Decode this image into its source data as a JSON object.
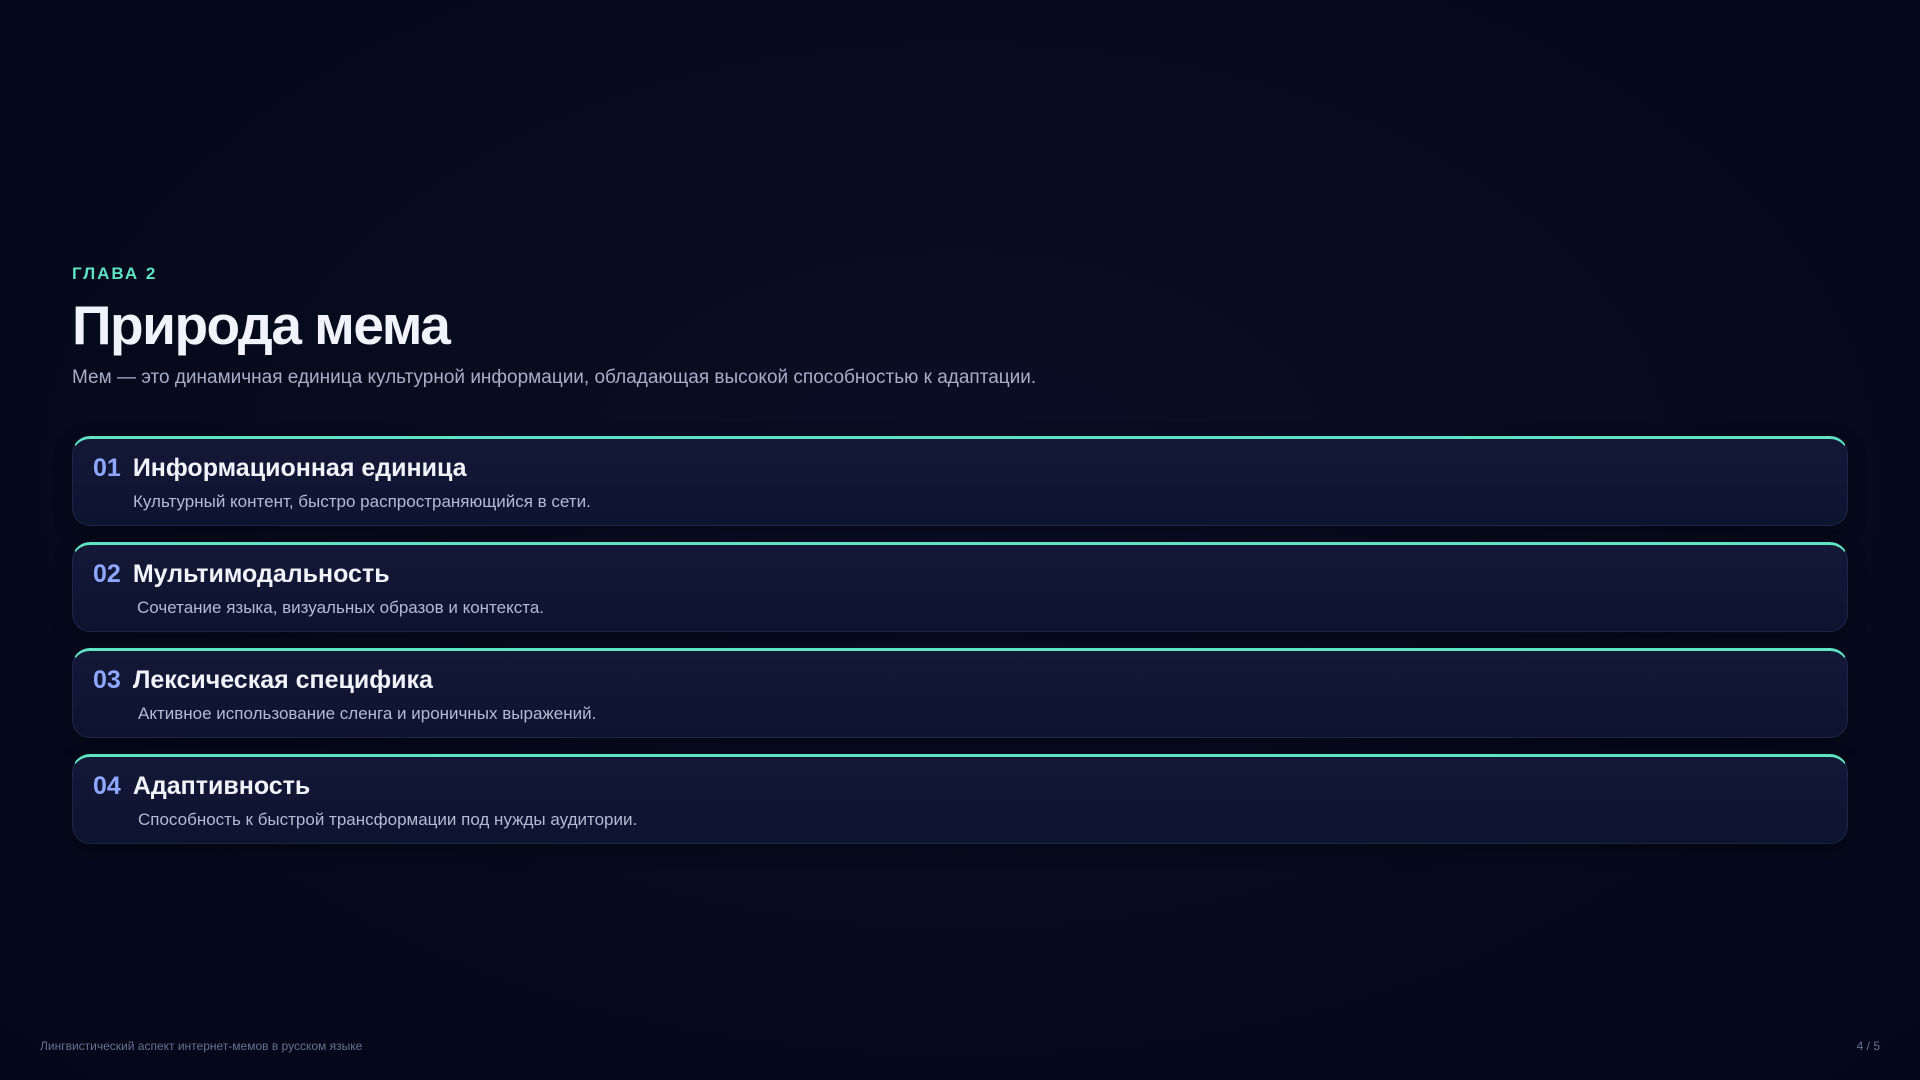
{
  "slide": {
    "eyebrow": "ГЛАВА 2",
    "title": "Природа мема",
    "subtitle": "Мем — это динамичная единица культурной информации, обладающая высокой способностью к адаптации."
  },
  "cards": [
    {
      "num": "01",
      "title": "Информационная единица",
      "desc": "Культурный контент, быстро распространяющийся в сети."
    },
    {
      "num": "02",
      "title": "Мультимодальность",
      "desc": "Сочетание языка, визуальных образов и контекста."
    },
    {
      "num": "03",
      "title": "Лексическая специфика",
      "desc": "Активное использование сленга и ироничных выражений."
    },
    {
      "num": "04",
      "title": "Адаптивность",
      "desc": "Способность к быстрой трансформации под нужды аудитории."
    }
  ],
  "footer": {
    "left": "Лингвистический аспект интернет-мемов в русском языке",
    "right": "4 / 5"
  },
  "colors": {
    "background": "#060a1c",
    "accent": "#5fe3c3",
    "number": "#8ea8ff",
    "card": "#121836"
  }
}
